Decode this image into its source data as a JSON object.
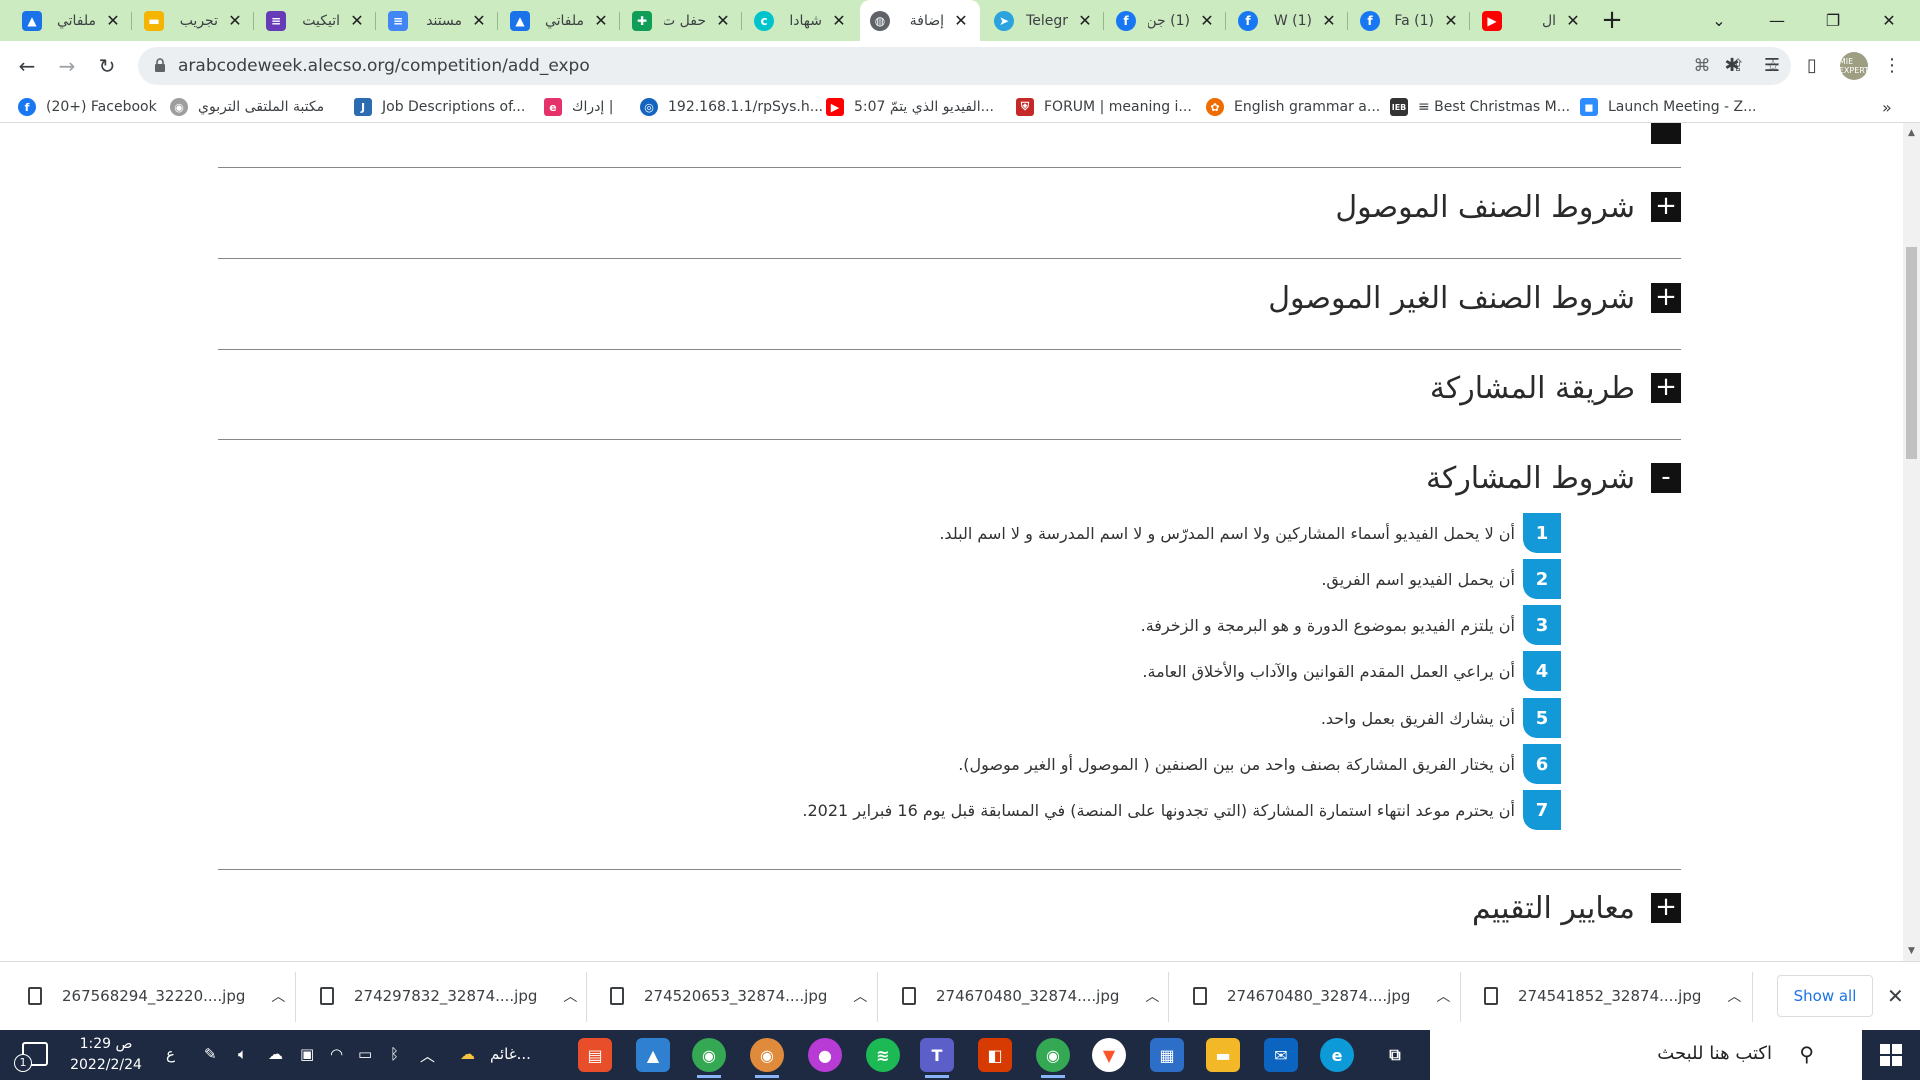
{
  "browser": {
    "tabs": [
      {
        "title": "ملفاتي",
        "icon": "google-drive-icon",
        "color": "#1a73e8"
      },
      {
        "title": "تجريب",
        "icon": "google-slides-icon",
        "color": "#f4b400"
      },
      {
        "title": "اتيكيت",
        "icon": "google-forms-icon",
        "color": "#673ab7"
      },
      {
        "title": "مستند",
        "icon": "google-docs-icon",
        "color": "#4285f4"
      },
      {
        "title": "ملفاتي",
        "icon": "google-drive-icon",
        "color": "#1a73e8"
      },
      {
        "title": "حفل ت",
        "icon": "google-sheets-icon",
        "color": "#0f9d58"
      },
      {
        "title": "شهادا",
        "icon": "canva-icon",
        "color": "#00c4cc"
      },
      {
        "title": "إضافة",
        "icon": "globe-icon",
        "color": "#5f6368"
      },
      {
        "title": "Telegr",
        "icon": "telegram-icon",
        "color": "#2aa3df"
      },
      {
        "title": "(1) جن",
        "icon": "facebook-icon",
        "color": "#1877f2"
      },
      {
        "title": "(1) W",
        "icon": "facebook-icon",
        "color": "#1877f2"
      },
      {
        "title": "(1) Fa",
        "icon": "facebook-icon",
        "color": "#1877f2"
      },
      {
        "title": "ال",
        "icon": "youtube-icon",
        "color": "#ff0000"
      }
    ],
    "new_tab_label": "+",
    "url": "arabcodeweek.alecso.org/competition/add_expo",
    "avatar_label": "MIE EXPERT",
    "bookmarks": [
      {
        "label": "(20+) Facebook",
        "icon": "facebook-icon",
        "color": "#1877f2"
      },
      {
        "label": "مكتبة الملتقى التربوي",
        "icon": "library-icon",
        "color": "#9e9e9e"
      },
      {
        "label": "Job Descriptions of...",
        "icon": "jobs-icon",
        "color": "#2b6cb0"
      },
      {
        "label": "إدراك |",
        "icon": "edraak-icon",
        "color": "#e5326b"
      },
      {
        "label": "192.168.1.1/rpSys.h...",
        "icon": "router-icon",
        "color": "#1565c0"
      },
      {
        "label": "5:07 الفيديو الذي يتمّ...",
        "icon": "youtube-icon",
        "color": "#ff0000"
      },
      {
        "label": "FORUM | meaning i...",
        "icon": "cambridge-icon",
        "color": "#c62828"
      },
      {
        "label": "English grammar a...",
        "icon": "grammar-icon",
        "color": "#ef6c00"
      },
      {
        "label": "≡ Best Christmas M...",
        "icon": "ieb-icon",
        "color": "#333333"
      },
      {
        "label": "Launch Meeting - Z...",
        "icon": "zoom-icon",
        "color": "#2d8cff"
      }
    ]
  },
  "page": {
    "sections": [
      {
        "title": "شروط الصنف الموصول",
        "toggle": "+"
      },
      {
        "title": "شروط الصنف الغير الموصول",
        "toggle": "+"
      },
      {
        "title": "طريقة المشاركة",
        "toggle": "+"
      },
      {
        "title": "شروط المشاركة",
        "toggle": "-"
      },
      {
        "title": "معايير التقييم",
        "toggle": "+"
      }
    ],
    "conditions": [
      {
        "num": "1",
        "text": "أن لا يحمل الفيديو أسماء المشاركين ولا اسم المدرّس و لا اسم المدرسة و لا اسم البلد."
      },
      {
        "num": "2",
        "text": "أن يحمل الفيديو اسم الفريق."
      },
      {
        "num": "3",
        "text": "أن يلتزم الفيديو بموضوع الدورة و هو البرمجة و الزخرفة."
      },
      {
        "num": "4",
        "text": "أن يراعي العمل المقدم القوانين والآداب والأخلاق العامة."
      },
      {
        "num": "5",
        "text": "أن يشارك الفريق بعمل واحد."
      },
      {
        "num": "6",
        "text": "أن يختار الفريق المشاركة بصنف واحد من بين الصنفين ( الموصول أو الغير موصول)."
      },
      {
        "num": "7",
        "text": "أن يحترم موعد انتهاء استمارة المشاركة (التي تجدونها على المنصة) في المسابقة قبل يوم 16 فبراير 2021."
      }
    ],
    "accent_color": "#1499d8"
  },
  "downloads": {
    "items": [
      {
        "name": "267568294_32220....jpg"
      },
      {
        "name": "274297832_32874....jpg"
      },
      {
        "name": "274520653_32874....jpg"
      },
      {
        "name": "274670480_32874....jpg"
      },
      {
        "name": "274670480_32874....jpg"
      },
      {
        "name": "274541852_32874....jpg"
      }
    ],
    "show_all": "Show all"
  },
  "taskbar": {
    "search_placeholder": "اكتب هنا للبحث",
    "time": "1:29 ص",
    "date": "2022/2/24",
    "weather": "غائم...",
    "lang": "ع",
    "notification_count": "1",
    "apps": [
      {
        "icon": "task-view-icon",
        "color": "#1d2a41"
      },
      {
        "icon": "edge-icon",
        "color": "#0c9bd8"
      },
      {
        "icon": "mail-icon",
        "color": "#0a64c0"
      },
      {
        "icon": "file-explorer-icon",
        "color": "#f2b827"
      },
      {
        "icon": "store-icon",
        "color": "#2d6ec9"
      },
      {
        "icon": "brave-icon",
        "color": "#ffffff"
      },
      {
        "icon": "chrome-icon",
        "color": "#34a853"
      },
      {
        "icon": "office-icon",
        "color": "#d83b01"
      },
      {
        "icon": "teams-icon",
        "color": "#5b5fc7"
      },
      {
        "icon": "spotify-icon",
        "color": "#1db954"
      },
      {
        "icon": "photo-app-icon",
        "color": "#b83bd6"
      },
      {
        "icon": "chrome-profile-icon",
        "color": "#e08a3c"
      },
      {
        "icon": "chrome-icon",
        "color": "#34a853"
      },
      {
        "icon": "photos-icon",
        "color": "#2f80d1"
      },
      {
        "icon": "presentation-icon",
        "color": "#e94e2b"
      }
    ]
  }
}
